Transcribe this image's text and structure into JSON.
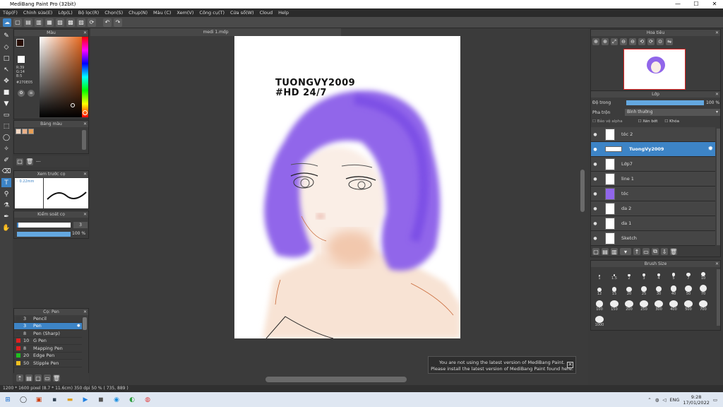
{
  "app": {
    "title": "MediBang Paint Pro (32bit)"
  },
  "window_controls": {
    "minimize": "—",
    "maximize": "☐",
    "close": "✕"
  },
  "menu": [
    "Tệp(F)",
    "Chỉnh sửa(E)",
    "Lớp(L)",
    "Bộ lọc(R)",
    "Chọn(S)",
    "Chụp(N)",
    "Màu (C)",
    "Xem(V)",
    "Công cụ(T)",
    "Cửa sổ(W)",
    "Cloud",
    "Help"
  ],
  "color_panel": {
    "title": "Màu",
    "r": "R:39",
    "g": "G:14",
    "b": "B:5",
    "hex": "#270E05",
    "fg": "#270e05",
    "bg": "#ffffff"
  },
  "palette": {
    "title": "Bảng màu",
    "swatches": [
      "#f5d9c4",
      "#e9b089",
      "#e89f55"
    ],
    "more": "---"
  },
  "brush_preview": {
    "title": "Xem trước cọ",
    "size": "0.22mm"
  },
  "brush_control": {
    "title": "Kiểm soát cọ",
    "size_value": "3",
    "opacity_value": "100 %",
    "opacity": 1.0
  },
  "brush_list": {
    "title": "Cọ: Pen",
    "items": [
      {
        "size": "3",
        "name": "Pencil",
        "color": "#3a3a3a"
      },
      {
        "size": "3",
        "name": "Pen",
        "color": "#3d84c6",
        "selected": true
      },
      {
        "size": "8",
        "name": "Pen (Sharp)",
        "color": "#3a3a3a"
      },
      {
        "size": "10",
        "name": "G Pen",
        "color": "#e02020"
      },
      {
        "size": "8",
        "name": "Mapping Pen",
        "color": "#e02020"
      },
      {
        "size": "20",
        "name": "Edge Pen",
        "color": "#20c020"
      },
      {
        "size": "50",
        "name": "Stipple Pen",
        "color": "#f0c020"
      }
    ]
  },
  "document": {
    "tab": "medi 1.mdp",
    "watermark_line1": "TUONGVY2009",
    "watermark_line2": "#HD 24/7"
  },
  "navigator": {
    "title": "Hoa tiêu"
  },
  "layers_panel": {
    "title": "Lớp",
    "opacity_label": "Độ trong",
    "opacity_value": "100 %",
    "opacity": 1.0,
    "blend_label": "Pha trộn",
    "blend_value": "Bình thường",
    "protect_alpha": "Bảo vệ alpha",
    "clipping": "Xén bớt",
    "lock": "Khóa",
    "layers": [
      {
        "name": "tóc 2"
      },
      {
        "name": "TuongVy2009",
        "selected": true
      },
      {
        "name": "Lớp7"
      },
      {
        "name": "line 1"
      },
      {
        "name": "tóc"
      },
      {
        "name": "da 2"
      },
      {
        "name": "da 1"
      },
      {
        "name": "Sketch"
      }
    ]
  },
  "brush_size": {
    "title": "Brush Size",
    "sizes": [
      "1",
      "1.5",
      "2",
      "3",
      "4",
      "5",
      "7",
      "10",
      "12",
      "15",
      "20",
      "25",
      "30",
      "40",
      "50",
      "70",
      "100",
      "150",
      "200",
      "250",
      "300",
      "400",
      "500",
      "700",
      "1000"
    ]
  },
  "notification": {
    "line1": "You are not using the latest version of MediBang Paint.",
    "line2": "Please install the latest version of MediBang Paint found here."
  },
  "status": {
    "text": "1200 * 1600 pixel   (8.7 * 11.6cm)   350 dpi   50 %   ( 735, 889 )"
  },
  "taskbar": {
    "lang": "ENG",
    "time": "9:28",
    "date": "17/01/2022"
  }
}
